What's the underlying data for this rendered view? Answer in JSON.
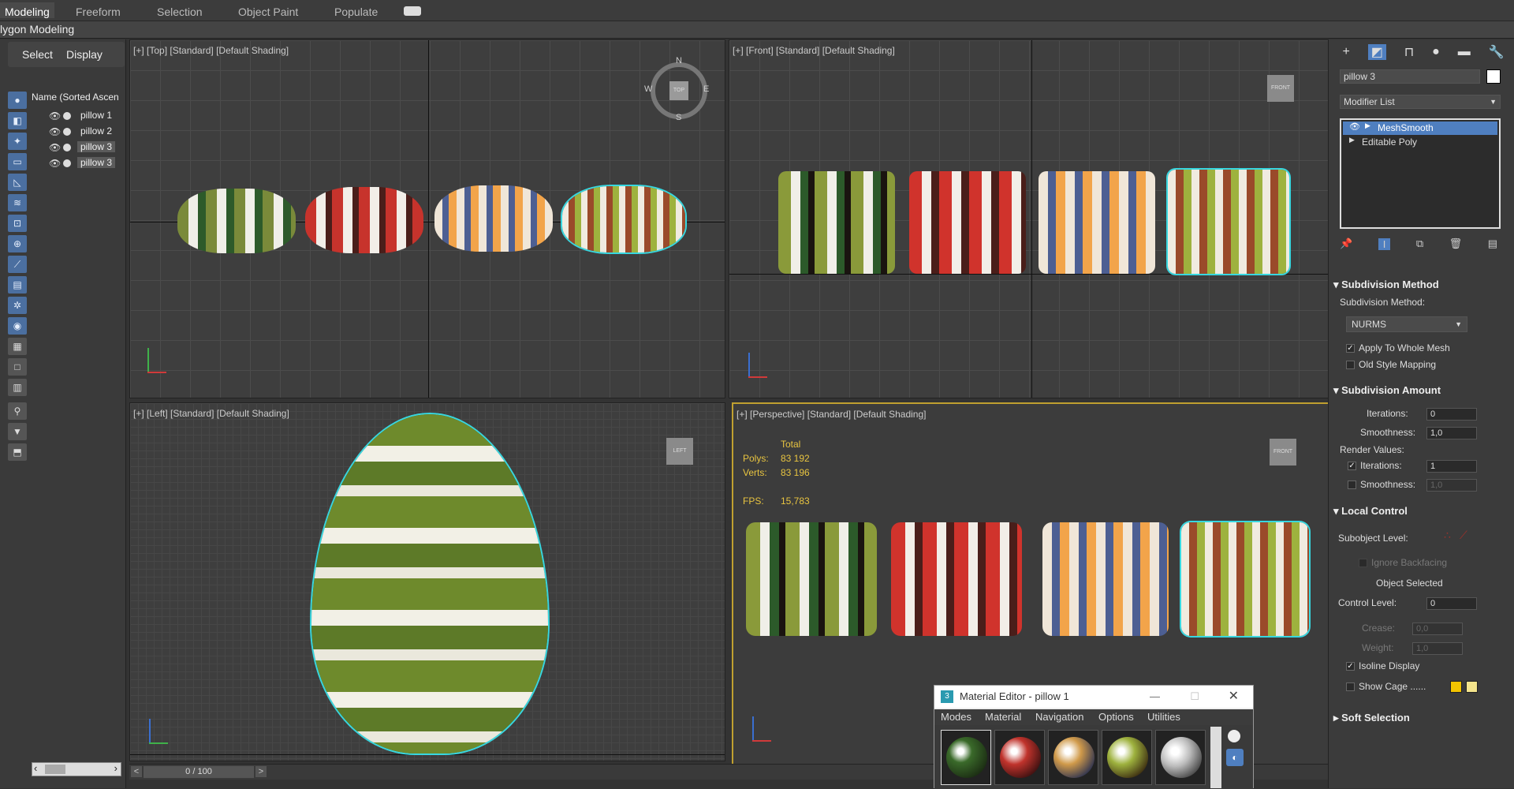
{
  "ribbon": {
    "tabs": [
      "Modeling",
      "Freeform",
      "Selection",
      "Object Paint",
      "Populate"
    ],
    "sub_title": "lygon Modeling"
  },
  "scene_explorer": {
    "tabs": [
      "Select",
      "Display"
    ],
    "column_header": "Name (Sorted Ascen",
    "items": [
      {
        "label": "pillow 1",
        "selected": false
      },
      {
        "label": "pillow 2",
        "selected": false
      },
      {
        "label": "pillow 3",
        "selected": true
      },
      {
        "label": "pillow 3",
        "selected": true
      }
    ]
  },
  "viewports": {
    "top": {
      "label": "[+] [Top] [Standard] [Default Shading]",
      "compass": {
        "n": "N",
        "s": "S",
        "e": "E",
        "w": "W",
        "cube": "TOP"
      }
    },
    "front": {
      "label": "[+] [Front] [Standard] [Default Shading]",
      "cube": "FRONT"
    },
    "left": {
      "label": "[+] [Left] [Standard] [Default Shading]",
      "cube": "LEFT"
    },
    "perspective": {
      "label": "[+] [Perspective] [Standard] [Default Shading]",
      "cube": "FRONT",
      "stats": {
        "total_label": "Total",
        "polys_label": "Polys:",
        "polys": "83 192",
        "verts_label": "Verts:",
        "verts": "83 196",
        "fps_label": "FPS:",
        "fps": "15,783"
      }
    }
  },
  "timeline": {
    "frame": "0 / 100"
  },
  "command_panel": {
    "object_name": "pillow 3",
    "modifier_list": "Modifier List",
    "stack": [
      {
        "label": "MeshSmooth",
        "selected": true
      },
      {
        "label": "Editable Poly",
        "selected": false
      }
    ],
    "subdivision_method": {
      "header": "Subdivision Method",
      "method_label": "Subdivision Method:",
      "method_value": "NURMS",
      "apply_whole": "Apply To Whole Mesh",
      "old_style": "Old Style Mapping"
    },
    "subdivision_amount": {
      "header": "Subdivision Amount",
      "iterations_label": "Iterations:",
      "iterations": "0",
      "smoothness_label": "Smoothness:",
      "smoothness": "1,0",
      "render_values": "Render Values:",
      "r_iterations_label": "Iterations:",
      "r_iterations": "1",
      "r_smoothness_label": "Smoothness:",
      "r_smoothness": "1,0"
    },
    "local_control": {
      "header": "Local Control",
      "subobject_level": "Subobject Level:",
      "ignore_backfacing": "Ignore Backfacing",
      "object_selected": "Object Selected",
      "control_level_label": "Control Level:",
      "control_level": "0",
      "crease_label": "Crease:",
      "crease": "0,0",
      "weight_label": "Weight:",
      "weight": "1,0",
      "isoline": "Isoline Display",
      "show_cage": "Show Cage ......"
    },
    "soft_selection": {
      "header": "Soft Selection"
    },
    "colors": {
      "cage1": "#f2c400",
      "cage2": "#f4e48c",
      "selection": "#37d7e0",
      "stack_sel": "#4f7fc0"
    }
  },
  "material_editor": {
    "title": "Material Editor - pillow 1",
    "menu": [
      "Modes",
      "Material",
      "Navigation",
      "Options",
      "Utilities"
    ]
  }
}
